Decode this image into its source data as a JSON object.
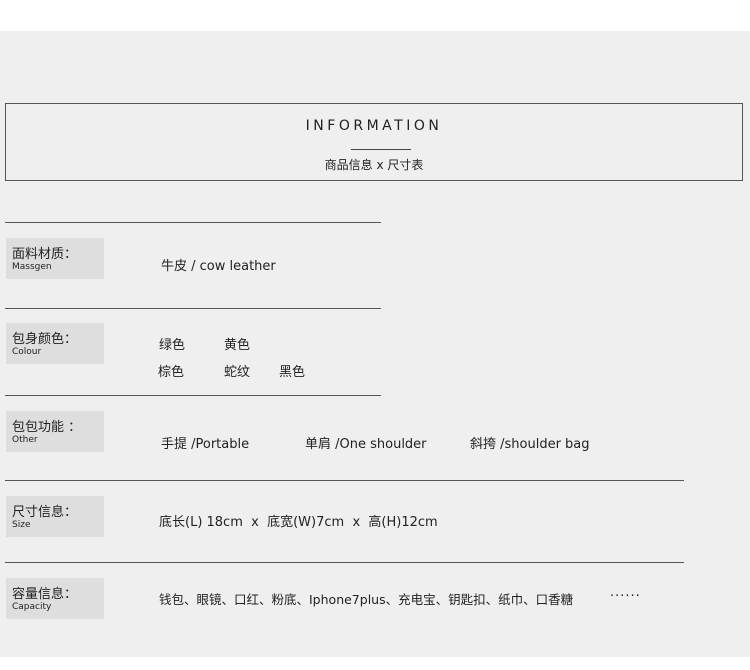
{
  "header": {
    "title": "INFORMATION",
    "subtitle": "商品信息 x 尺寸表"
  },
  "rows": {
    "material": {
      "label_zh": "面料材质：",
      "label_en": "Massgen",
      "value": "牛皮 / cow leather"
    },
    "colour": {
      "label_zh": "包身颜色：",
      "label_en": "Colour",
      "options": [
        "绿色",
        "黄色",
        "棕色",
        "蛇纹",
        "黑色"
      ]
    },
    "function": {
      "label_zh": "包包功能 ：",
      "label_en": "Other",
      "options": [
        "手提 /Portable",
        "单肩 /One shoulder",
        "斜挎 /shoulder bag"
      ]
    },
    "size": {
      "label_zh": "尺寸信息：",
      "label_en": "Size",
      "value": "底长(L) 18cm  x  底宽(W)7cm  x  高(H)12cm"
    },
    "capacity": {
      "label_zh": "容量信息：",
      "label_en": "Capacity",
      "value": "钱包、眼镜、口红、粉底、Iphone7plus、充电宝、钥匙扣、纸巾、口香糖",
      "ellipsis": "······"
    }
  }
}
